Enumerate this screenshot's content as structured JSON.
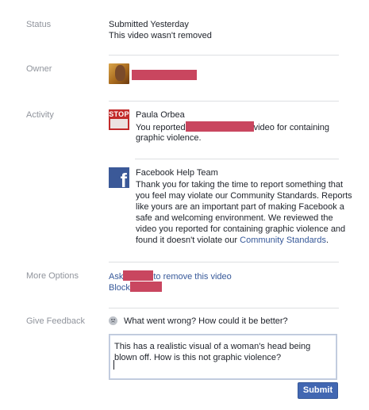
{
  "labels": {
    "status": "Status",
    "owner": "Owner",
    "activity": "Activity",
    "more_options": "More Options",
    "give_feedback": "Give Feedback"
  },
  "status": {
    "submitted": "Submitted Yesterday",
    "result": "This video wasn't removed"
  },
  "activity": {
    "report": {
      "author": "Paula Orbea",
      "avatar_text": "STOP",
      "line1_prefix": "You reported",
      "line1_suffix": "video for containing",
      "line2": "graphic violence."
    },
    "response": {
      "author": "Facebook Help Team",
      "lines": [
        "Thank you for taking the time to report something that",
        "you feel may violate our Community Standards. Reports",
        "like yours are an important part of making Facebook a",
        "safe and welcoming environment. We reviewed the",
        "video you reported for containing graphic violence and"
      ],
      "last_line_prefix": "found it doesn't violate our ",
      "community_standards_link": "Community Standards",
      "last_line_suffix": "."
    }
  },
  "more_options": {
    "ask_prefix": "Ask",
    "ask_suffix": "to remove this video",
    "block_prefix": "Block"
  },
  "feedback": {
    "prompt": "What went wrong? How could it be better?",
    "value": "This has a realistic visual of a woman's head being blown off. How is this not graphic violence?",
    "submit_label": "Submit"
  },
  "colors": {
    "link": "#365899",
    "muted": "#90949c",
    "redaction": "#c9465f",
    "button": "#4267b2"
  },
  "icons": {
    "owner_avatar": "profile-photo",
    "report_avatar": "stop-sign-avatar",
    "help_team_avatar": "facebook-logo",
    "feedback_face": "sad-face-icon"
  }
}
